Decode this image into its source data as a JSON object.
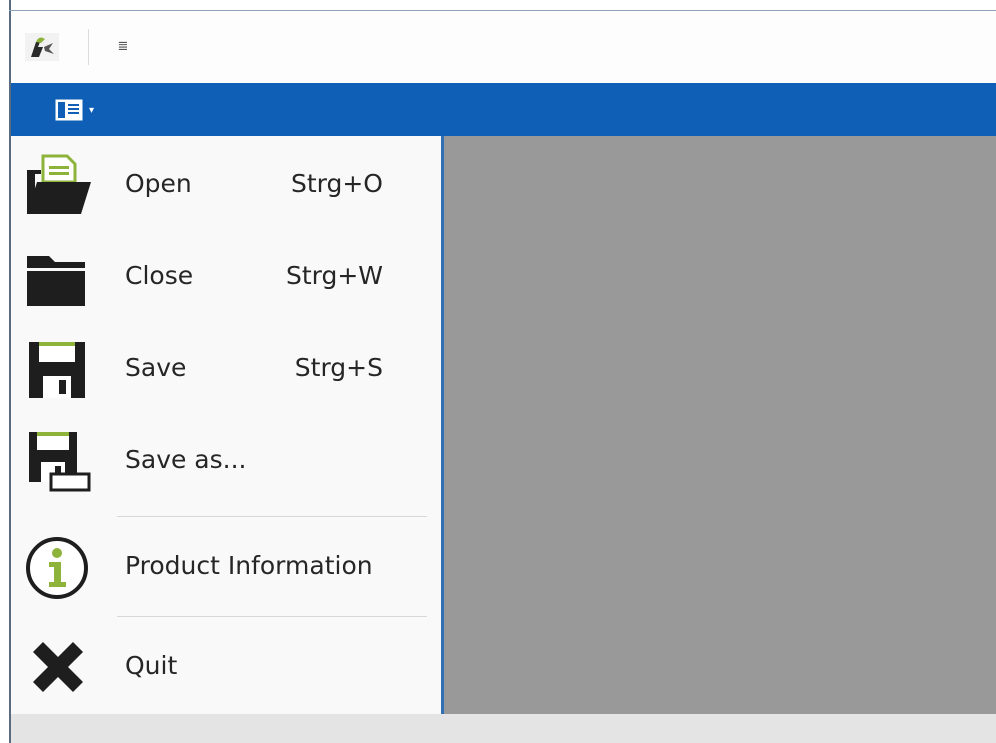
{
  "quick_access_toolbar": {
    "app_icon": "app-logo-icon",
    "customize_glyph": "≣"
  },
  "ribbon": {
    "app_menu_icon": "app-menu-icon",
    "dropdown_glyph": "▾",
    "color": "#0e5fb5"
  },
  "menu": {
    "items": [
      {
        "id": "open",
        "label": "Open",
        "shortcut": "Strg+O",
        "icon": "open-folder-icon"
      },
      {
        "id": "close",
        "label": "Close",
        "shortcut": "Strg+W",
        "icon": "folder-icon"
      },
      {
        "id": "save",
        "label": "Save",
        "shortcut": "Strg+S",
        "icon": "save-icon"
      },
      {
        "id": "save-as",
        "label": "Save as...",
        "shortcut": "",
        "icon": "save-as-icon"
      },
      {
        "id": "product-info",
        "label": "Product Information",
        "shortcut": "",
        "icon": "info-icon"
      },
      {
        "id": "quit",
        "label": "Quit",
        "shortcut": "",
        "icon": "close-x-icon"
      }
    ]
  },
  "colors": {
    "accent_green": "#8db33a",
    "panel_border": "#2f6fb4",
    "content_gray": "#999999"
  }
}
